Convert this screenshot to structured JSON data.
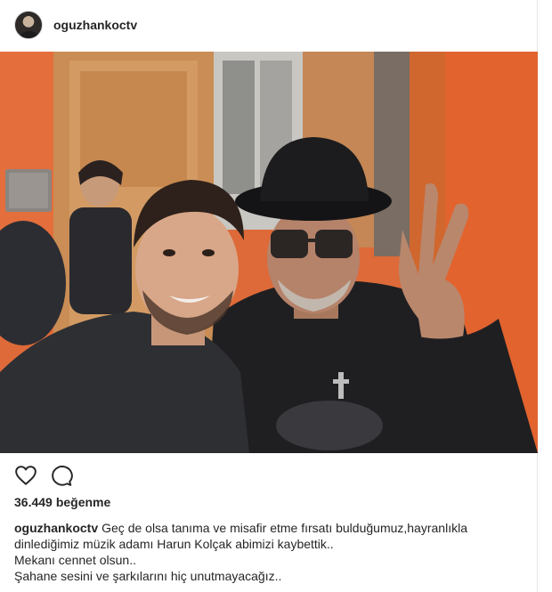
{
  "post": {
    "username": "oguzhankoctv",
    "likes_count": "36.449",
    "likes_label": "beğenme",
    "caption": {
      "author": "oguzhankoctv",
      "line1": "Geç de olsa tanıma ve misafir etme fırsatı bulduğumuz,hayranlıkla",
      "line2": "dinlediğimiz müzik adamı Harun Kolçak abimizi kaybettik..",
      "line3": "Mekanı cennet olsun..",
      "line4": "Şahane sesini ve şarkılarını hiç unutmayacağız.."
    }
  },
  "icons": {
    "avatar": "profile-photo",
    "like": "heart-outline-icon",
    "comment": "speech-bubble-icon"
  },
  "colors": {
    "wall": "#e06535",
    "text": "#262626",
    "border": "#e6e6e6"
  }
}
